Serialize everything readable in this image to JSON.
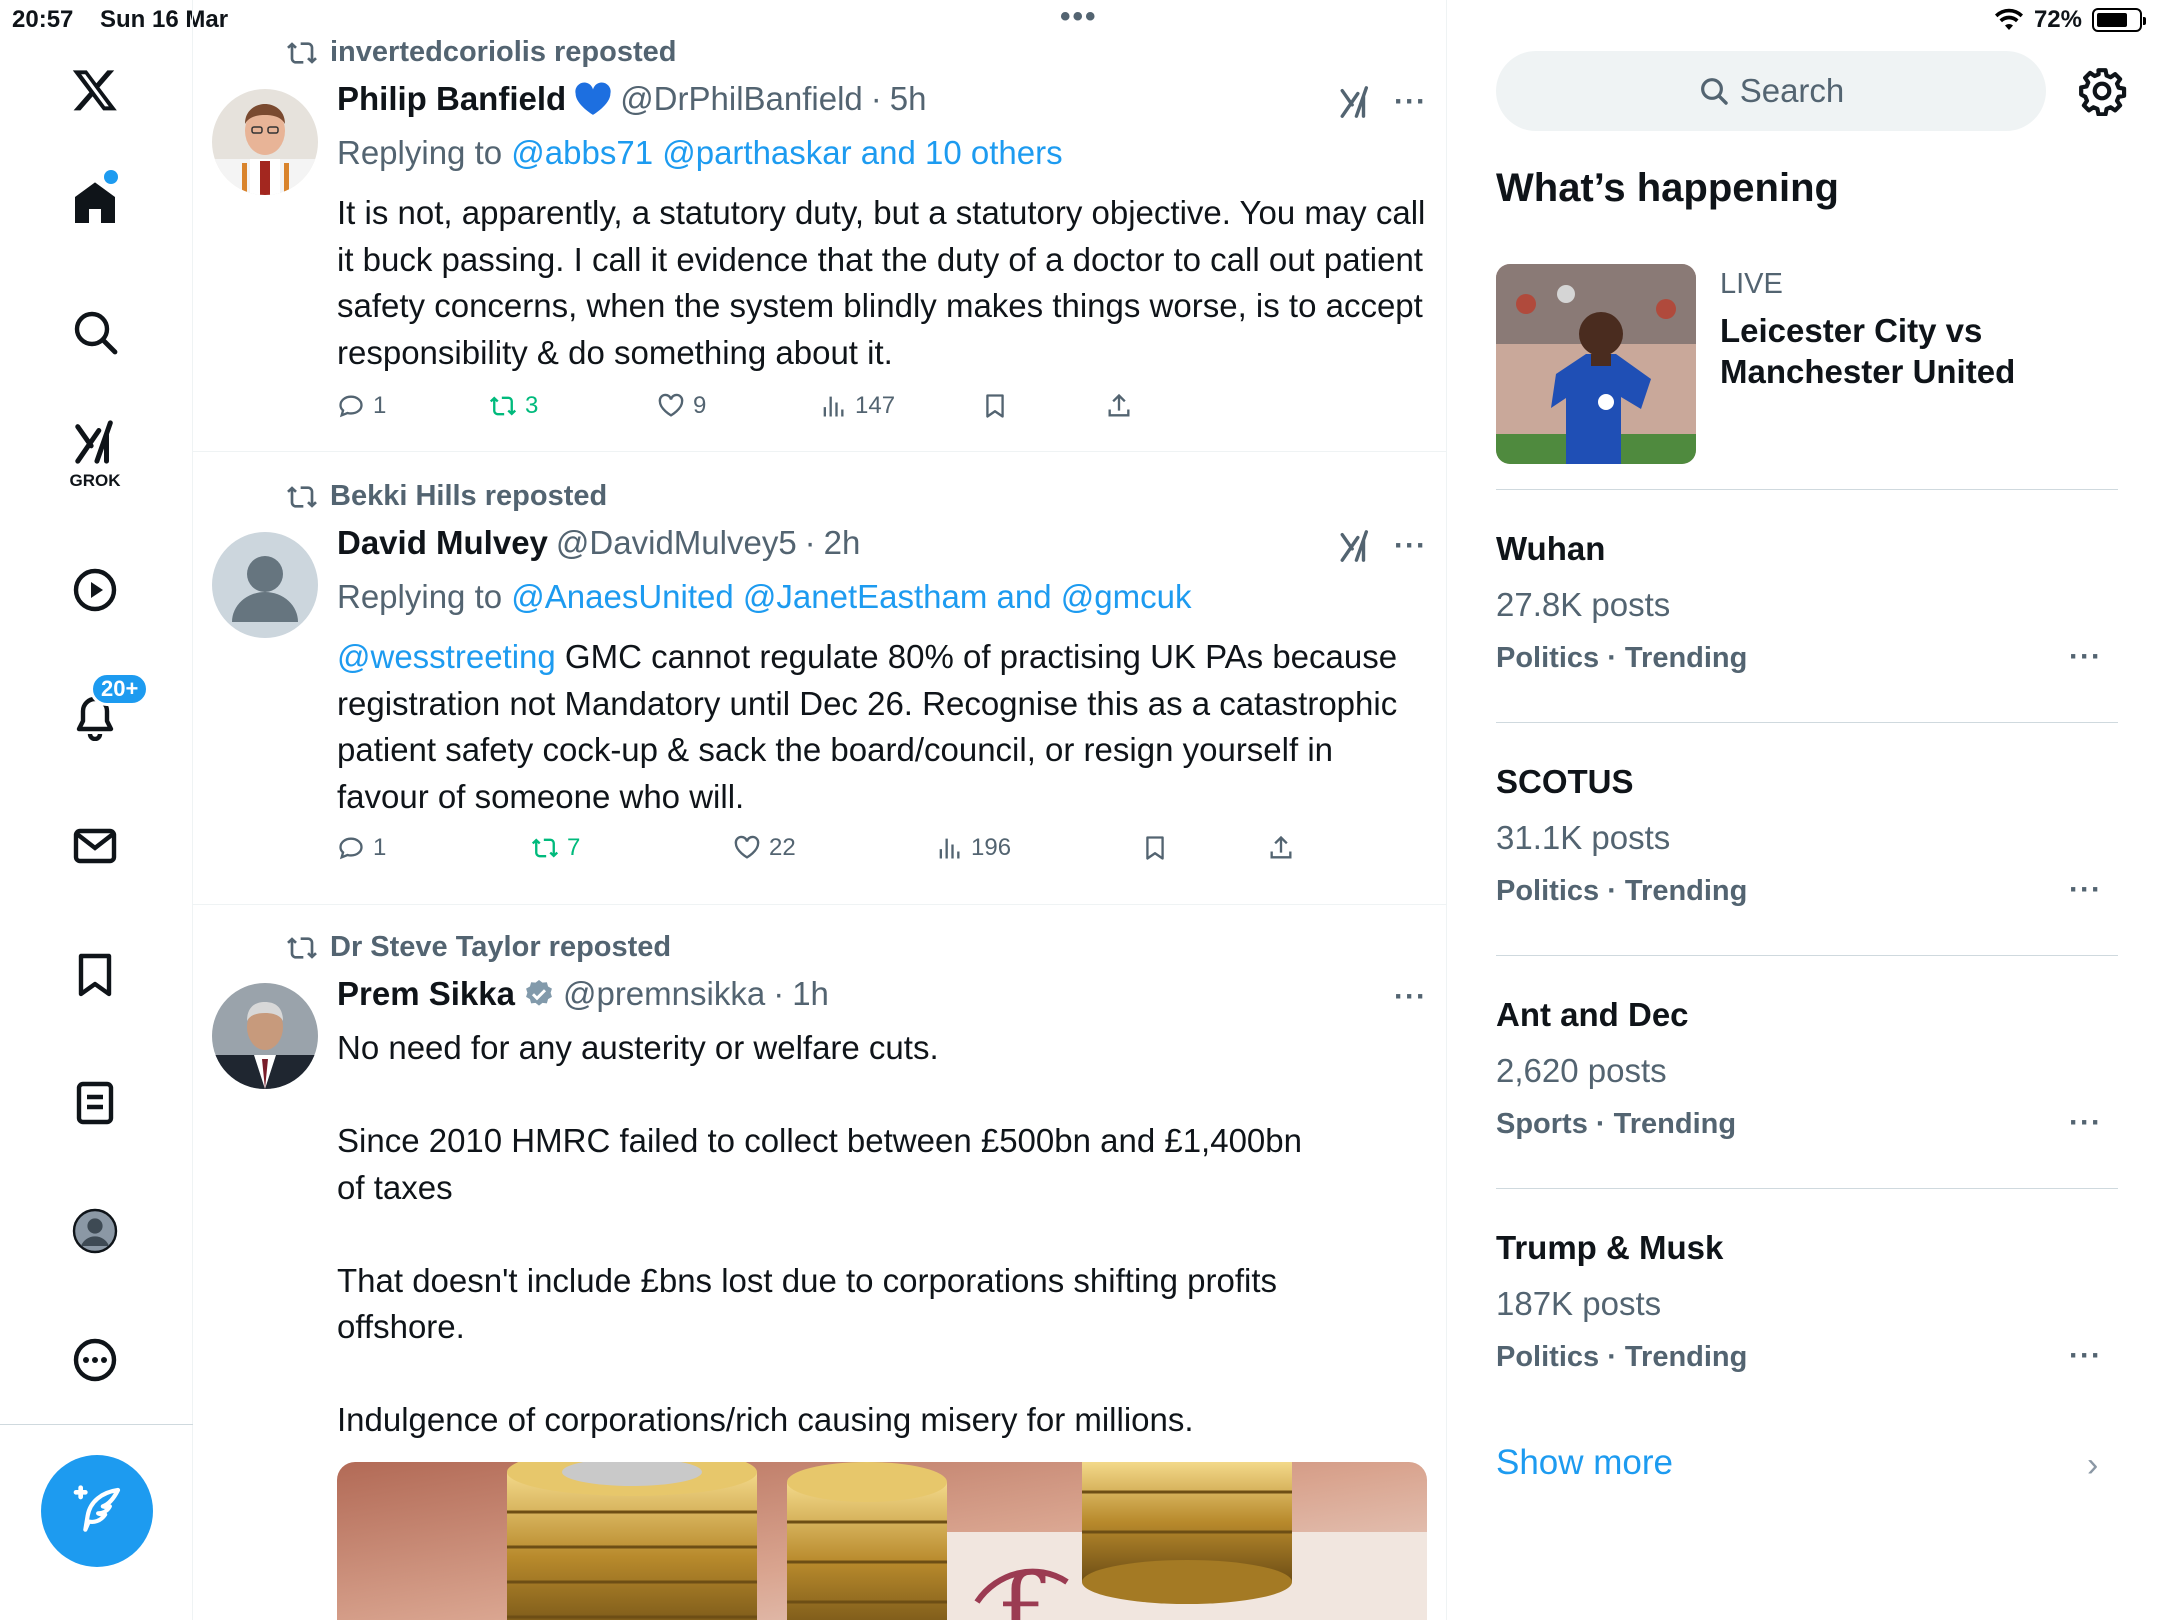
{
  "status": {
    "time": "20:57",
    "date": "Sun 16 Mar",
    "battery": "72%",
    "battery_level": 0.72
  },
  "nav": {
    "grok_label": "GROK",
    "notifications_badge": "20+"
  },
  "feed": {
    "tweets": [
      {
        "reposted_by": "invertedcoriolis reposted",
        "name": "Philip Banfield",
        "handle": "@DrPhilBanfield",
        "time": "5h",
        "replying_prefix": "Replying to",
        "replying_links": "@abbs71 @parthaskar and 10 others",
        "text": "It is not, apparently, a statutory duty, but a statutory objective. You may call it buck passing. I call it evidence that the duty of a doctor to call out patient safety concerns, when the system blindly makes things worse, is to accept responsibility & do something about it.",
        "replies": "1",
        "reposts": "3",
        "likes": "9",
        "views": "147"
      },
      {
        "reposted_by": "Bekki Hills reposted",
        "name": "David Mulvey",
        "handle": "@DavidMulvey5",
        "time": "2h",
        "replying_prefix": "Replying to",
        "replying_links": "@AnaesUnited @JanetEastham and @gmcuk",
        "mention": "@wesstreeting",
        "text": " GMC cannot regulate 80% of practising UK PAs because registration not Mandatory until Dec 26. Recognise this as a catastrophic patient safety cock-up & sack the board/council, or resign yourself in favour of someone who will.",
        "replies": "1",
        "reposts": "7",
        "likes": "22",
        "views": "196"
      },
      {
        "reposted_by": "Dr Steve Taylor reposted",
        "name": "Prem Sikka",
        "handle": "@premnsikka",
        "time": "1h",
        "para1": "No need for any austerity or welfare cuts.",
        "para2": "Since 2010 HMRC failed to collect between £500bn and £1,400bn of taxes",
        "para3": "That doesn't include £bns lost due to corporations shifting profits offshore.",
        "para4": "Indulgence of corporations/rich causing misery for millions."
      }
    ]
  },
  "sidebar": {
    "search_placeholder": "Search",
    "title": "What’s happening",
    "live": {
      "label": "LIVE",
      "title": "Leicester City vs Manchester United"
    },
    "trends": [
      {
        "name": "Wuhan",
        "count": "27.8K posts",
        "category": "Politics · Trending"
      },
      {
        "name": "SCOTUS",
        "count": "31.1K posts",
        "category": "Politics · Trending"
      },
      {
        "name": "Ant and Dec",
        "count": "2,620 posts",
        "category": "Sports · Trending"
      },
      {
        "name": "Trump & Musk",
        "count": "187K posts",
        "category": "Politics · Trending"
      }
    ],
    "show_more": "Show more"
  },
  "colors": {
    "accent": "#1d9bf0",
    "repost_green": "#00ba7c",
    "muted": "#536471"
  }
}
